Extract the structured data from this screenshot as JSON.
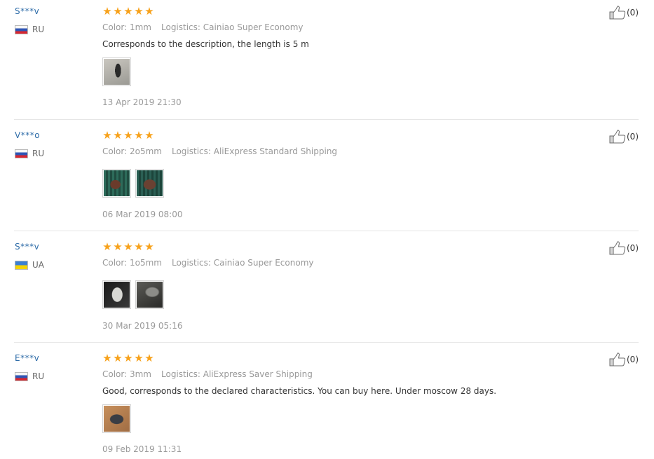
{
  "reviews": [
    {
      "user": "S***v",
      "country": "RU",
      "color": "Color: 1mm",
      "logistics": "Logistics: Cainiao Super Economy",
      "comment": "Corresponds to the description, the length is 5 m",
      "date": "13 Apr 2019 21:30",
      "helpful": "(0)",
      "rating": 5
    },
    {
      "user": "V***o",
      "country": "RU",
      "color": "Color: 2o5mm",
      "logistics": "Logistics: AliExpress Standard Shipping",
      "comment": "",
      "date": "06 Mar 2019 08:00",
      "helpful": "(0)",
      "rating": 5
    },
    {
      "user": "S***v",
      "country": "UA",
      "color": "Color: 1o5mm",
      "logistics": "Logistics: Cainiao Super Economy",
      "comment": "",
      "date": "30 Mar 2019 05:16",
      "helpful": "(0)",
      "rating": 5
    },
    {
      "user": "E***v",
      "country": "RU",
      "color": "Color: 3mm",
      "logistics": "Logistics: AliExpress Saver Shipping",
      "comment": "Good, corresponds to the declared characteristics. You can buy here. Under moscow 28 days.",
      "date": "09 Feb 2019 11:31",
      "helpful": "(0)",
      "rating": 5
    }
  ],
  "colors": {
    "star": "#f7a11a",
    "username": "#2e6ca8",
    "meta": "#999999",
    "text": "#333333",
    "divider": "#e6e6e6"
  },
  "icons": {
    "rating": "star-icon",
    "helpful": "thumbs-up-icon"
  }
}
